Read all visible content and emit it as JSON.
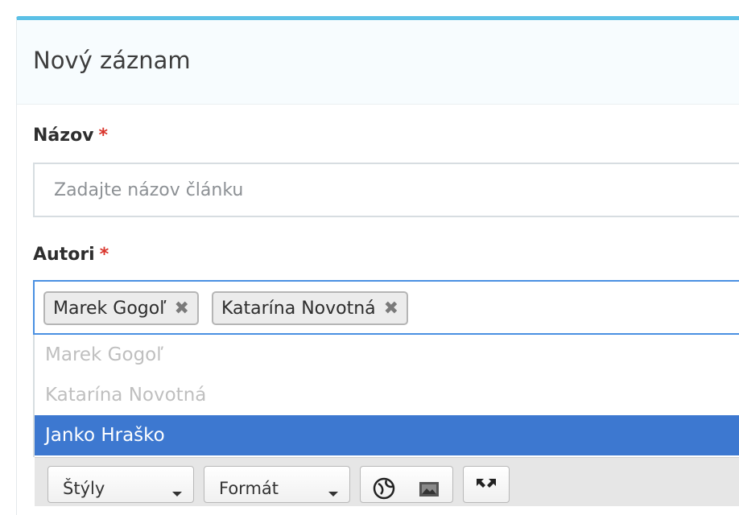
{
  "dialog": {
    "title": "Nový záznam"
  },
  "fields": {
    "title": {
      "label": "Názov",
      "required_mark": "*",
      "value": "",
      "placeholder": "Zadajte názov článku"
    },
    "authors": {
      "label": "Autori",
      "required_mark": "*",
      "selected": [
        {
          "name": "Marek Gogoľ",
          "remove": "✖"
        },
        {
          "name": "Katarína Novotná",
          "remove": "✖"
        }
      ],
      "options": [
        {
          "label": "Marek Gogoľ",
          "state": "disabled"
        },
        {
          "label": "Katarína Novotná",
          "state": "disabled"
        },
        {
          "label": "Janko Hraško",
          "state": "highlighted"
        }
      ]
    }
  },
  "editor_toolbar": {
    "styles_label": "Štýly",
    "format_label": "Formát",
    "icons": [
      "globe-icon",
      "image-icon",
      "maximize-icon"
    ]
  },
  "colors": {
    "accent_top": "#5bc0e6",
    "focus_border": "#4a90e2",
    "highlight": "#3d78d0",
    "required": "#d9342b"
  }
}
